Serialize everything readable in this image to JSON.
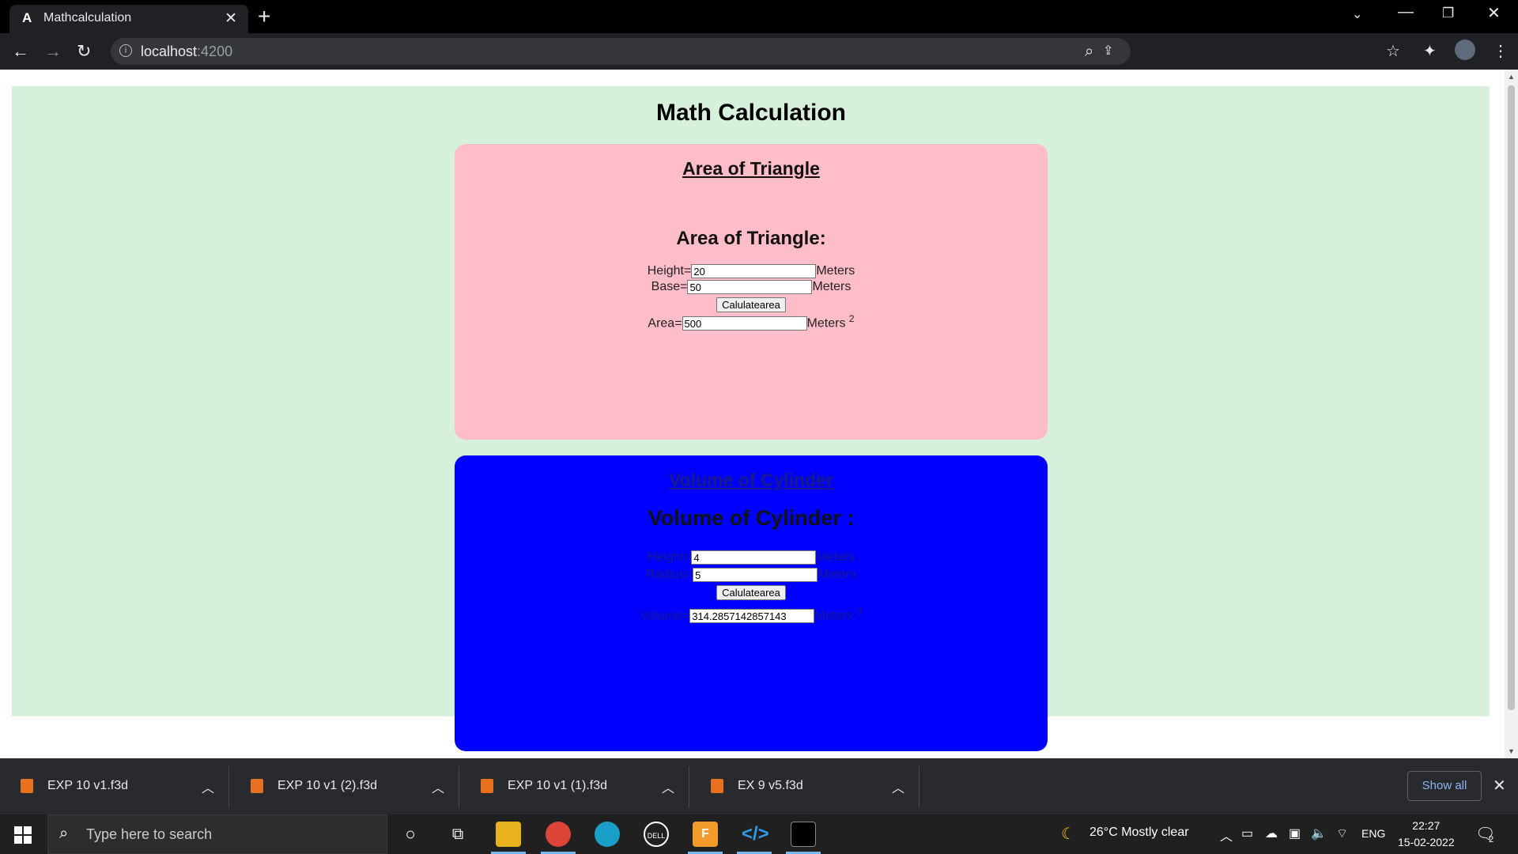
{
  "browser": {
    "tab_title": "Mathcalculation",
    "tab_favicon": "A",
    "url_host": "localhost",
    "url_port": ":4200"
  },
  "page": {
    "title": "Math Calculation",
    "triangle": {
      "heading": "Area of Triangle",
      "subheading": "Area of Triangle:",
      "height_label": "Height=",
      "height_value": "20",
      "height_unit": "Meters",
      "base_label": "Base=",
      "base_value": "50",
      "base_unit": "Meters",
      "button_label": "Calulatearea",
      "area_label": "Area=",
      "area_value": "500",
      "area_unit": "Meters",
      "area_power": "2"
    },
    "cylinder": {
      "heading": "Volume of Cylinder",
      "subheading": "Volume of Cylinder :",
      "height_label": "Height=",
      "height_value": "4",
      "height_unit": "Meters",
      "radius_label": "Radius=",
      "radius_value": "5",
      "radius_unit": "Meters",
      "button_label": "Calulatearea",
      "volume_label": "Volume=",
      "volume_value": "314.2857142857143",
      "volume_unit": "Meters",
      "volume_power": "3"
    }
  },
  "downloads": {
    "items": [
      "EXP 10 v1.f3d",
      "EXP 10 v1 (2).f3d",
      "EXP 10 v1 (1).f3d",
      "EX 9 v5.f3d"
    ],
    "show_all": "Show all"
  },
  "taskbar": {
    "search_placeholder": "Type here to search",
    "weather": "26°C  Mostly clear",
    "language": "ENG",
    "time": "22:27",
    "date": "15-02-2022",
    "notification_count": "2"
  },
  "colors": {
    "app_background": "#d7f0dc",
    "triangle_card": "#ffbcc9",
    "cylinder_card": "#0000ff"
  }
}
